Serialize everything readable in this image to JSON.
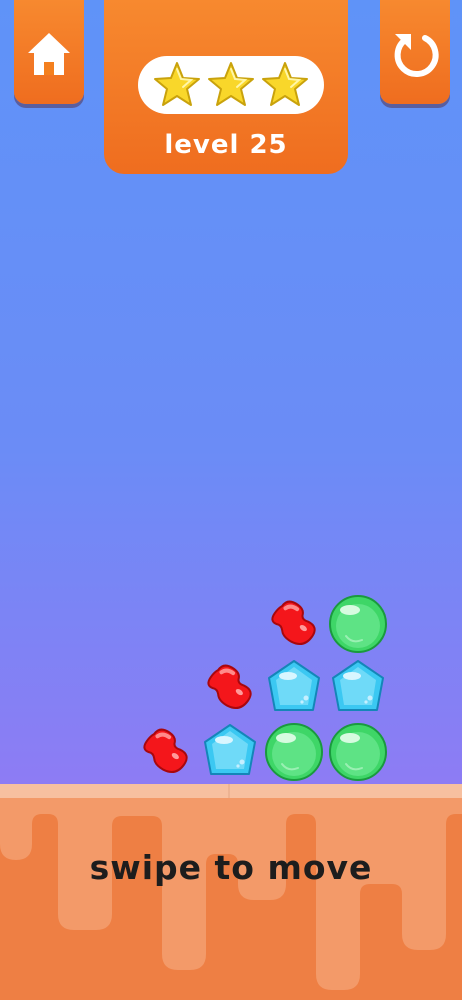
{
  "header": {
    "level_label": "level 25",
    "stars_earned": 3,
    "stars_total": 3
  },
  "buttons": {
    "home_icon": "home-icon",
    "restart_icon": "restart-icon"
  },
  "board": {
    "rows": [
      [
        "",
        "",
        "",
        "red-jelly-bean",
        "green-bubble"
      ],
      [
        "",
        "",
        "red-jelly-bean",
        "blue-gem",
        "blue-gem"
      ],
      [
        "",
        "red-jelly-bean",
        "blue-gem",
        "green-bubble",
        "green-bubble"
      ]
    ]
  },
  "hint": "swipe to move",
  "colors": {
    "background_top": "#5f93f8",
    "background_bottom": "#9a78f2",
    "button_orange": "#f7892f",
    "ground_light": "#f3a174",
    "ground_dark": "#ee7a3c",
    "star_yellow": "#f9d72a",
    "red_candy": "#f4161b",
    "blue_candy": "#3bc8f2",
    "green_candy": "#3ed667"
  }
}
